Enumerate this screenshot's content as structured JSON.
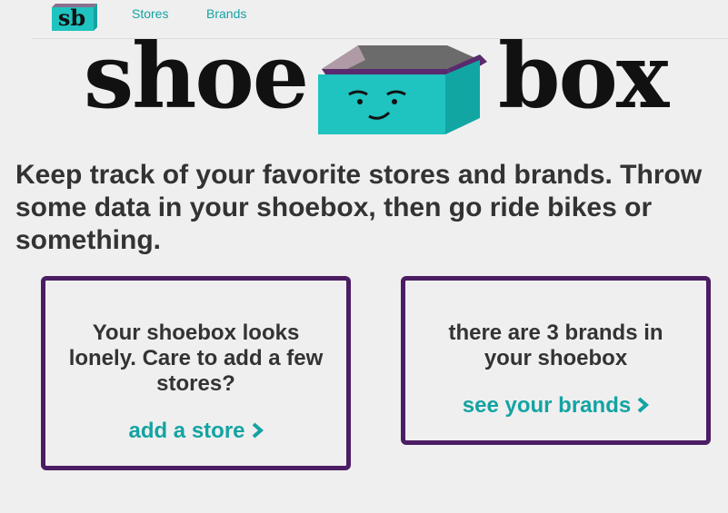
{
  "nav": {
    "logo_text": "sb",
    "links": [
      {
        "label": "Stores"
      },
      {
        "label": "Brands"
      }
    ]
  },
  "hero": {
    "word_left": "shoe",
    "word_right": "box"
  },
  "tagline": "Keep track of your favorite stores and brands. Throw some data in your shoebox, then go ride bikes or something.",
  "cards": {
    "stores": {
      "message": "Your shoebox looks lonely. Care to add a few stores?",
      "link_label": "add a store",
      "link_icon": "chevron-right-icon"
    },
    "brands": {
      "message": "there are 3 brands in your shoebox",
      "link_label": "see your brands",
      "link_icon": "chevron-right-icon"
    }
  },
  "colors": {
    "background": "#efefef",
    "accent": "#14a3a3",
    "card_border": "#4b1d63",
    "box_teal": "#1fc3bf",
    "box_purple": "#5a2a6e",
    "text": "#333333"
  }
}
